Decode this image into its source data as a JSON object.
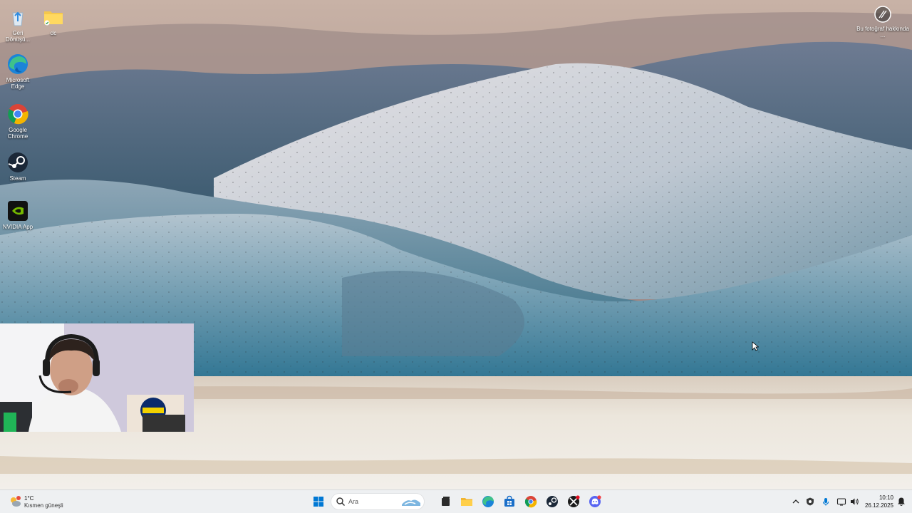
{
  "desktop": {
    "icons": [
      {
        "name": "recycle-bin",
        "label": "Geri Dönüşü..."
      },
      {
        "name": "folder",
        "label": "dc"
      },
      {
        "name": "edge",
        "label": "Microsoft Edge"
      },
      {
        "name": "chrome",
        "label": "Google Chrome"
      },
      {
        "name": "steam",
        "label": "Steam"
      },
      {
        "name": "nvidia",
        "label": "NVIDIA App"
      }
    ],
    "photo_info": {
      "label": "Bu fotoğraf hakkında ..."
    }
  },
  "taskbar": {
    "weather": {
      "temp": "1°C",
      "condition": "Kısmen güneşli"
    },
    "search": {
      "placeholder": "Ara"
    },
    "pinned": [
      "start-icon",
      "search-icon",
      "task-view-icon",
      "file-explorer-icon",
      "edge-icon",
      "microsoft-store-icon",
      "chrome-icon",
      "steam-icon",
      "xbox-icon",
      "discord-icon"
    ],
    "clock": {
      "time": "10:10",
      "date": "26.12.2025"
    }
  },
  "colors": {
    "taskbar_bg": "#eef0f2",
    "accent": "#0078d4"
  }
}
